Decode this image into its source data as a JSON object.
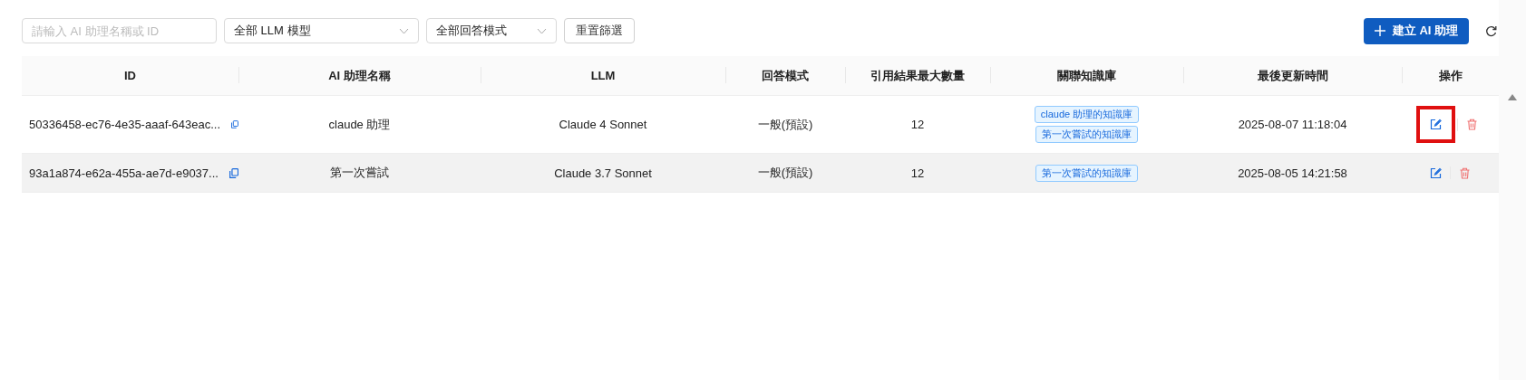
{
  "filters": {
    "search": {
      "placeholder": "請輸入 AI 助理名稱或 ID"
    },
    "selects": [
      {
        "value": "全部 LLM 模型"
      },
      {
        "value": "全部回答模式"
      }
    ],
    "reset_button": "重置篩選"
  },
  "create_button": "建立 AI 助理",
  "table": {
    "columns": [
      "ID",
      "AI 助理名稱",
      "LLM",
      "回答模式",
      "引用結果最大數量",
      "關聯知識庫",
      "最後更新時間",
      "操作"
    ],
    "rows": [
      {
        "id": "50336458-ec76-4e35-aaaf-643eac...",
        "name": "claude 助理",
        "llm": "Claude 4 Sonnet",
        "mode": "一般(預設)",
        "max_results": "12",
        "knowledge_bases": [
          "claude 助理的知識庫",
          "第一次嘗試的知識庫"
        ],
        "updated": "2025-08-07 11:18:04",
        "hovered": false,
        "edit_highlighted": true
      },
      {
        "id": "93a1a874-e62a-455a-ae7d-e9037...",
        "name": "第一次嘗試",
        "llm": "Claude 3.7 Sonnet",
        "mode": "一般(預設)",
        "max_results": "12",
        "knowledge_bases": [
          "第一次嘗試的知識庫"
        ],
        "updated": "2025-08-05 14:21:58",
        "hovered": true,
        "edit_highlighted": false
      }
    ]
  }
}
